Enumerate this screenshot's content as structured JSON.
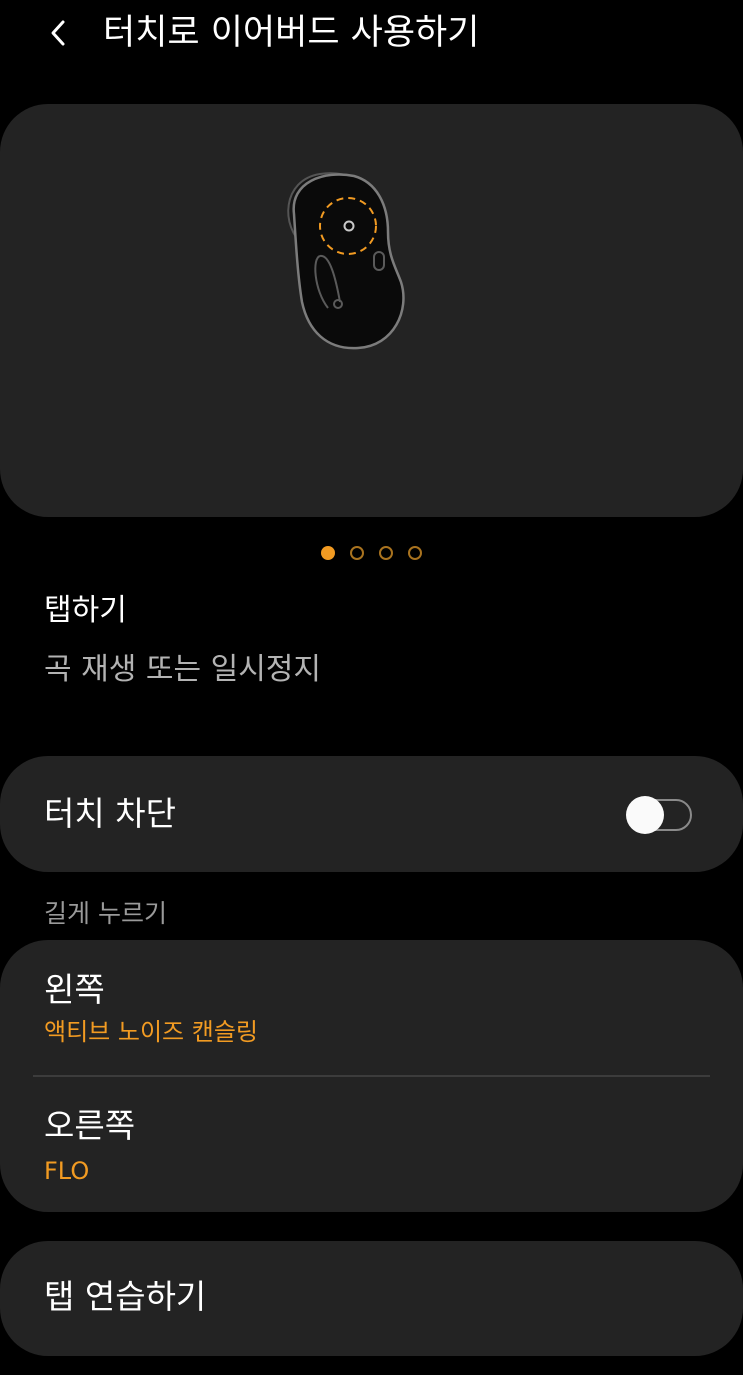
{
  "header": {
    "title": "터치로 이어버드 사용하기",
    "back_icon": "chevron-left-icon"
  },
  "illustration": {
    "subject": "earbud-touch-area-icon",
    "accent_color": "#f29b22"
  },
  "pager": {
    "total": 4,
    "current": 1
  },
  "gesture": {
    "title": "탭하기",
    "description": "곡 재생 또는 일시정지"
  },
  "touch_block": {
    "label": "터치 차단",
    "enabled": false
  },
  "long_press": {
    "header": "길게 누르기",
    "left": {
      "title": "왼쪽",
      "value": "액티브 노이즈 캔슬링"
    },
    "right": {
      "title": "오른쪽",
      "value": "FLO"
    }
  },
  "practice": {
    "label": "탭 연습하기"
  },
  "colors": {
    "background": "#000000",
    "card": "#232323",
    "accent": "#f29b22",
    "secondary_text": "#b3b3b3"
  }
}
